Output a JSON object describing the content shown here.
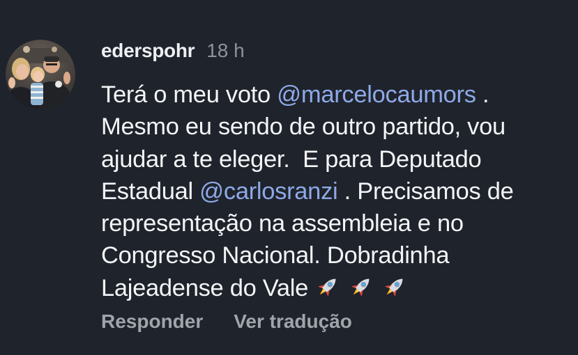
{
  "comment": {
    "username": "ederspohr",
    "time": "18 h",
    "avatar_icon": "profile-photo-avatar",
    "lines": [
      {
        "before": "Terá o meu voto ",
        "mention": "@marcelocaumors",
        "after": " ."
      },
      {
        "text": "Mesmo eu sendo de outro partido, vou"
      },
      {
        "text": "ajudar a te eleger.  E para Deputado"
      },
      {
        "before": "Estadual ",
        "mention": "@carlosranzi",
        "after": " . Precisamos de"
      },
      {
        "text": "representação na assembleia e no"
      },
      {
        "text": "Congresso Nacional. Dobradinha"
      },
      {
        "text": "Lajeadense do Vale "
      }
    ],
    "emoji": [
      "rocket-icon",
      "rocket-icon",
      "rocket-icon"
    ]
  },
  "actions": {
    "reply_label": "Responder",
    "translate_label": "Ver tradução"
  },
  "colors": {
    "background": "#1f232b",
    "text": "#f4f5f7",
    "mention": "#8ea9e8",
    "muted": "#8e939b"
  }
}
